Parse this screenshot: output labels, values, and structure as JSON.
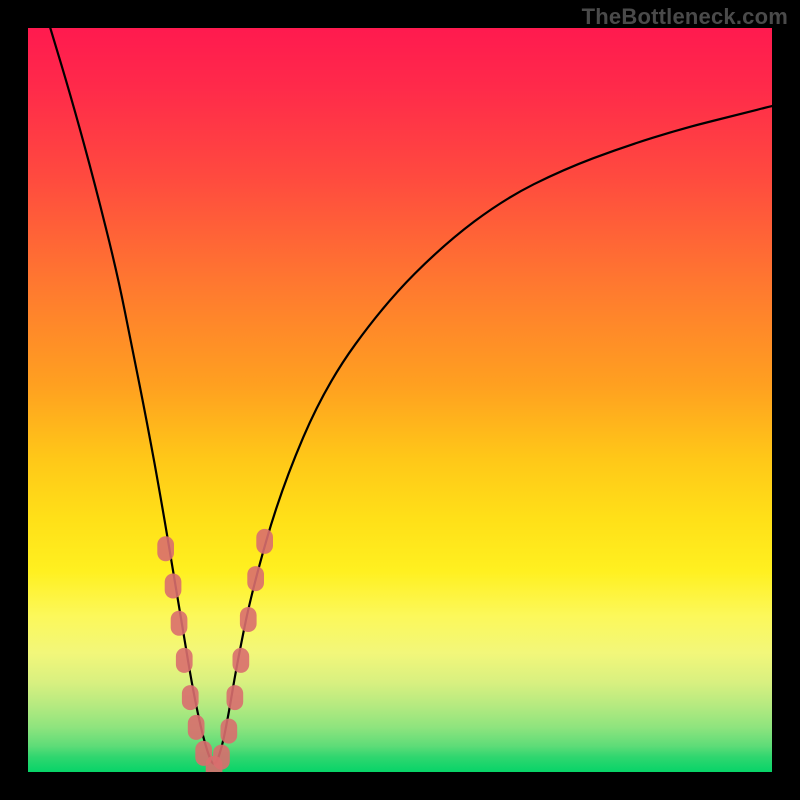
{
  "watermark": "TheBottleneck.com",
  "colors": {
    "background": "#000000",
    "watermark_text": "#4a4a4a",
    "curve": "#000000",
    "marker": "#d96e6e",
    "gradient_top": "#ff1a4f",
    "gradient_bottom": "#07d468"
  },
  "chart_data": {
    "type": "line",
    "title": "",
    "xlabel": "",
    "ylabel": "",
    "xlim": [
      0,
      100
    ],
    "ylim": [
      0,
      100
    ],
    "grid": false,
    "legend": false,
    "series": [
      {
        "name": "bottleneck-curve",
        "x": [
          3,
          6,
          9,
          12,
          14,
          16,
          18,
          19.5,
          21,
          22,
          23,
          24,
          25,
          26,
          27,
          28,
          30,
          34,
          40,
          48,
          56,
          64,
          72,
          80,
          88,
          96,
          100
        ],
        "y": [
          100,
          90,
          79,
          67,
          57,
          47,
          36,
          27,
          18,
          12,
          7,
          3,
          0.5,
          3,
          8,
          14,
          24,
          38,
          52,
          63,
          71,
          77,
          81,
          84,
          86.5,
          88.5,
          89.5
        ]
      }
    ],
    "markers": [
      {
        "x": 18.5,
        "y": 30,
        "r": 1.4
      },
      {
        "x": 19.5,
        "y": 25,
        "r": 1.4
      },
      {
        "x": 20.3,
        "y": 20,
        "r": 1.4
      },
      {
        "x": 21.0,
        "y": 15,
        "r": 1.4
      },
      {
        "x": 21.8,
        "y": 10,
        "r": 1.4
      },
      {
        "x": 22.6,
        "y": 6,
        "r": 1.4
      },
      {
        "x": 23.6,
        "y": 2.5,
        "r": 1.4
      },
      {
        "x": 25.0,
        "y": 0.5,
        "r": 1.4
      },
      {
        "x": 26.0,
        "y": 2.0,
        "r": 1.4
      },
      {
        "x": 27.0,
        "y": 5.5,
        "r": 1.4
      },
      {
        "x": 27.8,
        "y": 10.0,
        "r": 1.4
      },
      {
        "x": 28.6,
        "y": 15.0,
        "r": 1.4
      },
      {
        "x": 29.6,
        "y": 20.5,
        "r": 1.4
      },
      {
        "x": 30.6,
        "y": 26.0,
        "r": 1.4
      },
      {
        "x": 31.8,
        "y": 31.0,
        "r": 1.4
      }
    ],
    "notes": "V-shaped curve with minimum near x≈25%. y is percent of plot height from bottom. Background is a continuous vertical gradient red→yellow→green. Pink rounded markers cluster along both branches near the bottom of the V."
  }
}
